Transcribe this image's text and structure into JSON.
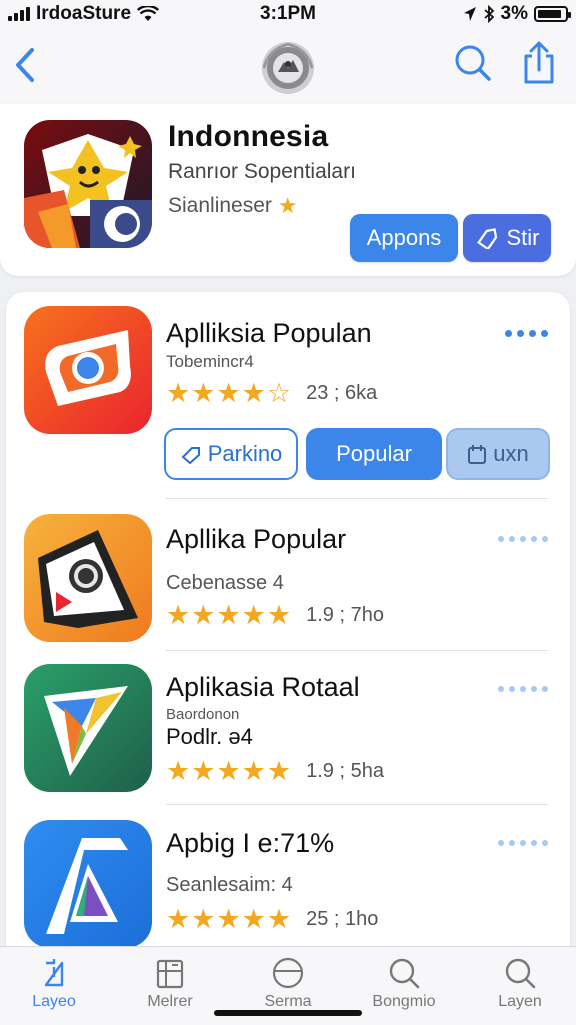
{
  "status_bar": {
    "carrier": "IrdoaSture",
    "time": "3:1PM",
    "battery_percent": "3%",
    "battery_level": 0.9
  },
  "nav": {
    "back_icon": "chevron-left-icon",
    "logo_icon": "emblem-icon",
    "search_icon": "search-icon",
    "share_icon": "share-icon"
  },
  "featured": {
    "title": "Indonnesia",
    "subtitle": "Ranrıor Sopentiaları",
    "tagline": "Sianlineser",
    "primary_button": "Appons",
    "secondary_button": "Stir"
  },
  "apps": [
    {
      "name": "Aplliksia Populan",
      "subtitle": "Tobemincr4",
      "rating": 3.5,
      "rating_meta": "23 ; 6ka",
      "chips": [
        "Parkino",
        "Popular",
        "uxn"
      ]
    },
    {
      "name": "Apllika Popular",
      "subtitle": "Cebenasse 4",
      "rating": 5,
      "rating_meta": "1.9 ; 7ho"
    },
    {
      "name": "Aplikasia Rotaal",
      "subtitle": "Baordonon",
      "subtitle2": "Podlr. ə4",
      "rating": 5,
      "rating_meta": "1.9 ; 5ha"
    },
    {
      "name": "Apbig I e:71%",
      "subtitle": "Seanlesaim: 4",
      "rating": 5,
      "rating_meta": "25 ; 1ho"
    }
  ],
  "tabs": [
    {
      "label": "Layeo",
      "icon": "today-icon",
      "active": true
    },
    {
      "label": "Melrer",
      "icon": "apps-icon",
      "active": false
    },
    {
      "label": "Serma",
      "icon": "circle-icon",
      "active": false
    },
    {
      "label": "Bongmio",
      "icon": "search-icon",
      "active": false
    },
    {
      "label": "Layen",
      "icon": "search-icon",
      "active": false
    }
  ],
  "colors": {
    "accent": "#3b86e8",
    "star": "#f4a81d",
    "background": "#eef0f4"
  }
}
